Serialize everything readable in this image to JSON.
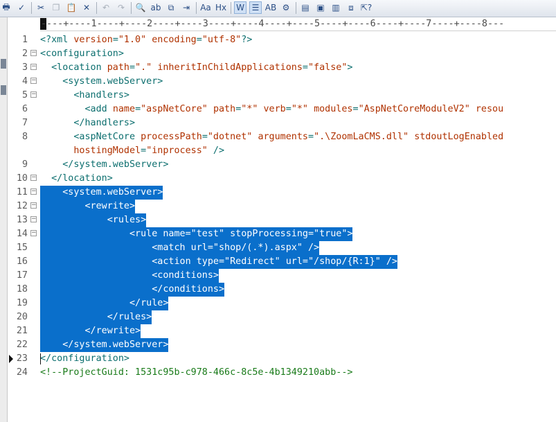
{
  "toolbar": {
    "buttons": [
      {
        "name": "print-icon",
        "glyph": "🖶",
        "state": "normal"
      },
      {
        "name": "spellcheck-icon",
        "glyph": "✓",
        "state": "normal"
      },
      {
        "name": "cut-icon",
        "glyph": "✂",
        "state": "normal"
      },
      {
        "name": "copy-icon",
        "glyph": "❐",
        "state": "disabled"
      },
      {
        "name": "paste-icon",
        "glyph": "📋",
        "state": "normal"
      },
      {
        "name": "delete-icon",
        "glyph": "✕",
        "state": "normal"
      },
      {
        "name": "undo-icon",
        "glyph": "↶",
        "state": "disabled"
      },
      {
        "name": "redo-icon",
        "glyph": "↷",
        "state": "disabled"
      },
      {
        "name": "find-icon",
        "glyph": "🔍",
        "state": "normal"
      },
      {
        "name": "replace-icon",
        "glyph": "ab",
        "state": "normal"
      },
      {
        "name": "find-in-files-icon",
        "glyph": "⧉",
        "state": "normal"
      },
      {
        "name": "goto-line-icon",
        "glyph": "⇥",
        "state": "normal"
      },
      {
        "name": "font-icon",
        "glyph": "Aa",
        "state": "normal"
      },
      {
        "name": "hex-icon",
        "glyph": "Hx",
        "state": "normal"
      },
      {
        "name": "word-wrap-icon",
        "glyph": "W",
        "state": "active"
      },
      {
        "name": "indent-icon",
        "glyph": "☰",
        "state": "active"
      },
      {
        "name": "column-mode-icon",
        "glyph": "AB",
        "state": "normal"
      },
      {
        "name": "settings-icon",
        "glyph": "⚙",
        "state": "normal"
      },
      {
        "name": "view-icon-1",
        "glyph": "▤",
        "state": "normal"
      },
      {
        "name": "view-icon-2",
        "glyph": "▣",
        "state": "normal"
      },
      {
        "name": "view-icon-3",
        "glyph": "▥",
        "state": "normal"
      },
      {
        "name": "view-icon-4",
        "glyph": "⧈",
        "state": "normal"
      },
      {
        "name": "help-pointer-icon",
        "glyph": "⇱?",
        "state": "normal"
      }
    ]
  },
  "ruler": {
    "text": "----+----1----+----2----+----3----+----4----+----5----+----6----+----7----+----8---"
  },
  "lines": [
    {
      "num": "1",
      "fold": "",
      "selected": false,
      "tokens": [
        [
          "pi",
          "<?xml "
        ],
        [
          "attr",
          "version"
        ],
        [
          "punct",
          "="
        ],
        [
          "val",
          "\"1.0\""
        ],
        [
          "pi",
          " "
        ],
        [
          "attr",
          "encoding"
        ],
        [
          "punct",
          "="
        ],
        [
          "val",
          "\"utf-8\""
        ],
        [
          "pi",
          "?>"
        ]
      ]
    },
    {
      "num": "2",
      "fold": "⊟",
      "selected": false,
      "tokens": [
        [
          "tag",
          "<configuration>"
        ]
      ]
    },
    {
      "num": "3",
      "fold": "⊟",
      "selected": false,
      "tokens": [
        [
          "tag",
          "  <location "
        ],
        [
          "attr",
          "path"
        ],
        [
          "punct",
          "="
        ],
        [
          "val",
          "\".\""
        ],
        [
          "tag",
          " "
        ],
        [
          "attr",
          "inheritInChildApplications"
        ],
        [
          "punct",
          "="
        ],
        [
          "val",
          "\"false\""
        ],
        [
          "tag",
          ">"
        ]
      ]
    },
    {
      "num": "4",
      "fold": "⊟",
      "selected": false,
      "tokens": [
        [
          "tag",
          "    <system.webServer>"
        ]
      ]
    },
    {
      "num": "5",
      "fold": "⊟",
      "selected": false,
      "tokens": [
        [
          "tag",
          "      <handlers>"
        ]
      ]
    },
    {
      "num": "6",
      "fold": "",
      "selected": false,
      "tokens": [
        [
          "tag",
          "        <add "
        ],
        [
          "attr",
          "name"
        ],
        [
          "punct",
          "="
        ],
        [
          "val",
          "\"aspNetCore\""
        ],
        [
          "tag",
          " "
        ],
        [
          "attr",
          "path"
        ],
        [
          "punct",
          "="
        ],
        [
          "val",
          "\"*\""
        ],
        [
          "tag",
          " "
        ],
        [
          "attr",
          "verb"
        ],
        [
          "punct",
          "="
        ],
        [
          "val",
          "\"*\""
        ],
        [
          "tag",
          " "
        ],
        [
          "attr",
          "modules"
        ],
        [
          "punct",
          "="
        ],
        [
          "val",
          "\"AspNetCoreModuleV2\""
        ],
        [
          "tag",
          " "
        ],
        [
          "attr",
          "resou"
        ]
      ]
    },
    {
      "num": "7",
      "fold": "",
      "selected": false,
      "tokens": [
        [
          "tag",
          "      </handlers>"
        ]
      ]
    },
    {
      "num": "8",
      "fold": "",
      "selected": false,
      "tokens": [
        [
          "tag",
          "      <aspNetCore "
        ],
        [
          "attr",
          "processPath"
        ],
        [
          "punct",
          "="
        ],
        [
          "val",
          "\"dotnet\""
        ],
        [
          "tag",
          " "
        ],
        [
          "attr",
          "arguments"
        ],
        [
          "punct",
          "="
        ],
        [
          "val",
          "\".\\ZoomLaCMS.dll\""
        ],
        [
          "tag",
          " "
        ],
        [
          "attr",
          "stdoutLogEnabled"
        ]
      ]
    },
    {
      "num": "",
      "fold": "",
      "selected": false,
      "tokens": [
        [
          "tag",
          "      "
        ],
        [
          "attr",
          "hostingModel"
        ],
        [
          "punct",
          "="
        ],
        [
          "val",
          "\"inprocess\""
        ],
        [
          "tag",
          " />"
        ]
      ]
    },
    {
      "num": "9",
      "fold": "",
      "selected": false,
      "tokens": [
        [
          "tag",
          "    </system.webServer>"
        ]
      ]
    },
    {
      "num": "10",
      "fold": "⊟",
      "selected": false,
      "tokens": [
        [
          "tag",
          "  </location>"
        ]
      ]
    },
    {
      "num": "11",
      "fold": "⊟",
      "selected": true,
      "tokens": [
        [
          "tag",
          "    <system.webServer>"
        ]
      ]
    },
    {
      "num": "12",
      "fold": "⊟",
      "selected": true,
      "tokens": [
        [
          "tag",
          "        <rewrite>"
        ]
      ]
    },
    {
      "num": "13",
      "fold": "⊟",
      "selected": true,
      "tokens": [
        [
          "tag",
          "            <rules>"
        ]
      ]
    },
    {
      "num": "14",
      "fold": "⊟",
      "selected": true,
      "tokens": [
        [
          "tag",
          "                <rule name=\"test\" stopProcessing=\"true\">"
        ]
      ]
    },
    {
      "num": "15",
      "fold": "",
      "selected": true,
      "tokens": [
        [
          "tag",
          "                    <match url=\"shop/(.*).aspx\" />"
        ]
      ]
    },
    {
      "num": "16",
      "fold": "",
      "selected": true,
      "tokens": [
        [
          "tag",
          "                    <action type=\"Redirect\" url=\"/shop/{R:1}\" />"
        ]
      ]
    },
    {
      "num": "17",
      "fold": "",
      "selected": true,
      "tokens": [
        [
          "tag",
          "                    <conditions>"
        ]
      ]
    },
    {
      "num": "18",
      "fold": "",
      "selected": true,
      "tokens": [
        [
          "tag",
          "                    </conditions>"
        ]
      ]
    },
    {
      "num": "19",
      "fold": "",
      "selected": true,
      "tokens": [
        [
          "tag",
          "                </rule>"
        ]
      ]
    },
    {
      "num": "20",
      "fold": "",
      "selected": true,
      "tokens": [
        [
          "tag",
          "            </rules>"
        ]
      ]
    },
    {
      "num": "21",
      "fold": "",
      "selected": true,
      "tokens": [
        [
          "tag",
          "        </rewrite>"
        ]
      ]
    },
    {
      "num": "22",
      "fold": "",
      "selected": true,
      "tokens": [
        [
          "tag",
          "    </system.webServer>"
        ]
      ]
    },
    {
      "num": "23",
      "fold": "",
      "selected": false,
      "current": true,
      "tokens": [
        [
          "tag",
          "</configuration>"
        ]
      ]
    },
    {
      "num": "24",
      "fold": "",
      "selected": false,
      "tokens": [
        [
          "comment",
          "<!--ProjectGuid: 1531c95b-c978-466c-8c5e-4b1349210abb-->"
        ]
      ]
    }
  ]
}
